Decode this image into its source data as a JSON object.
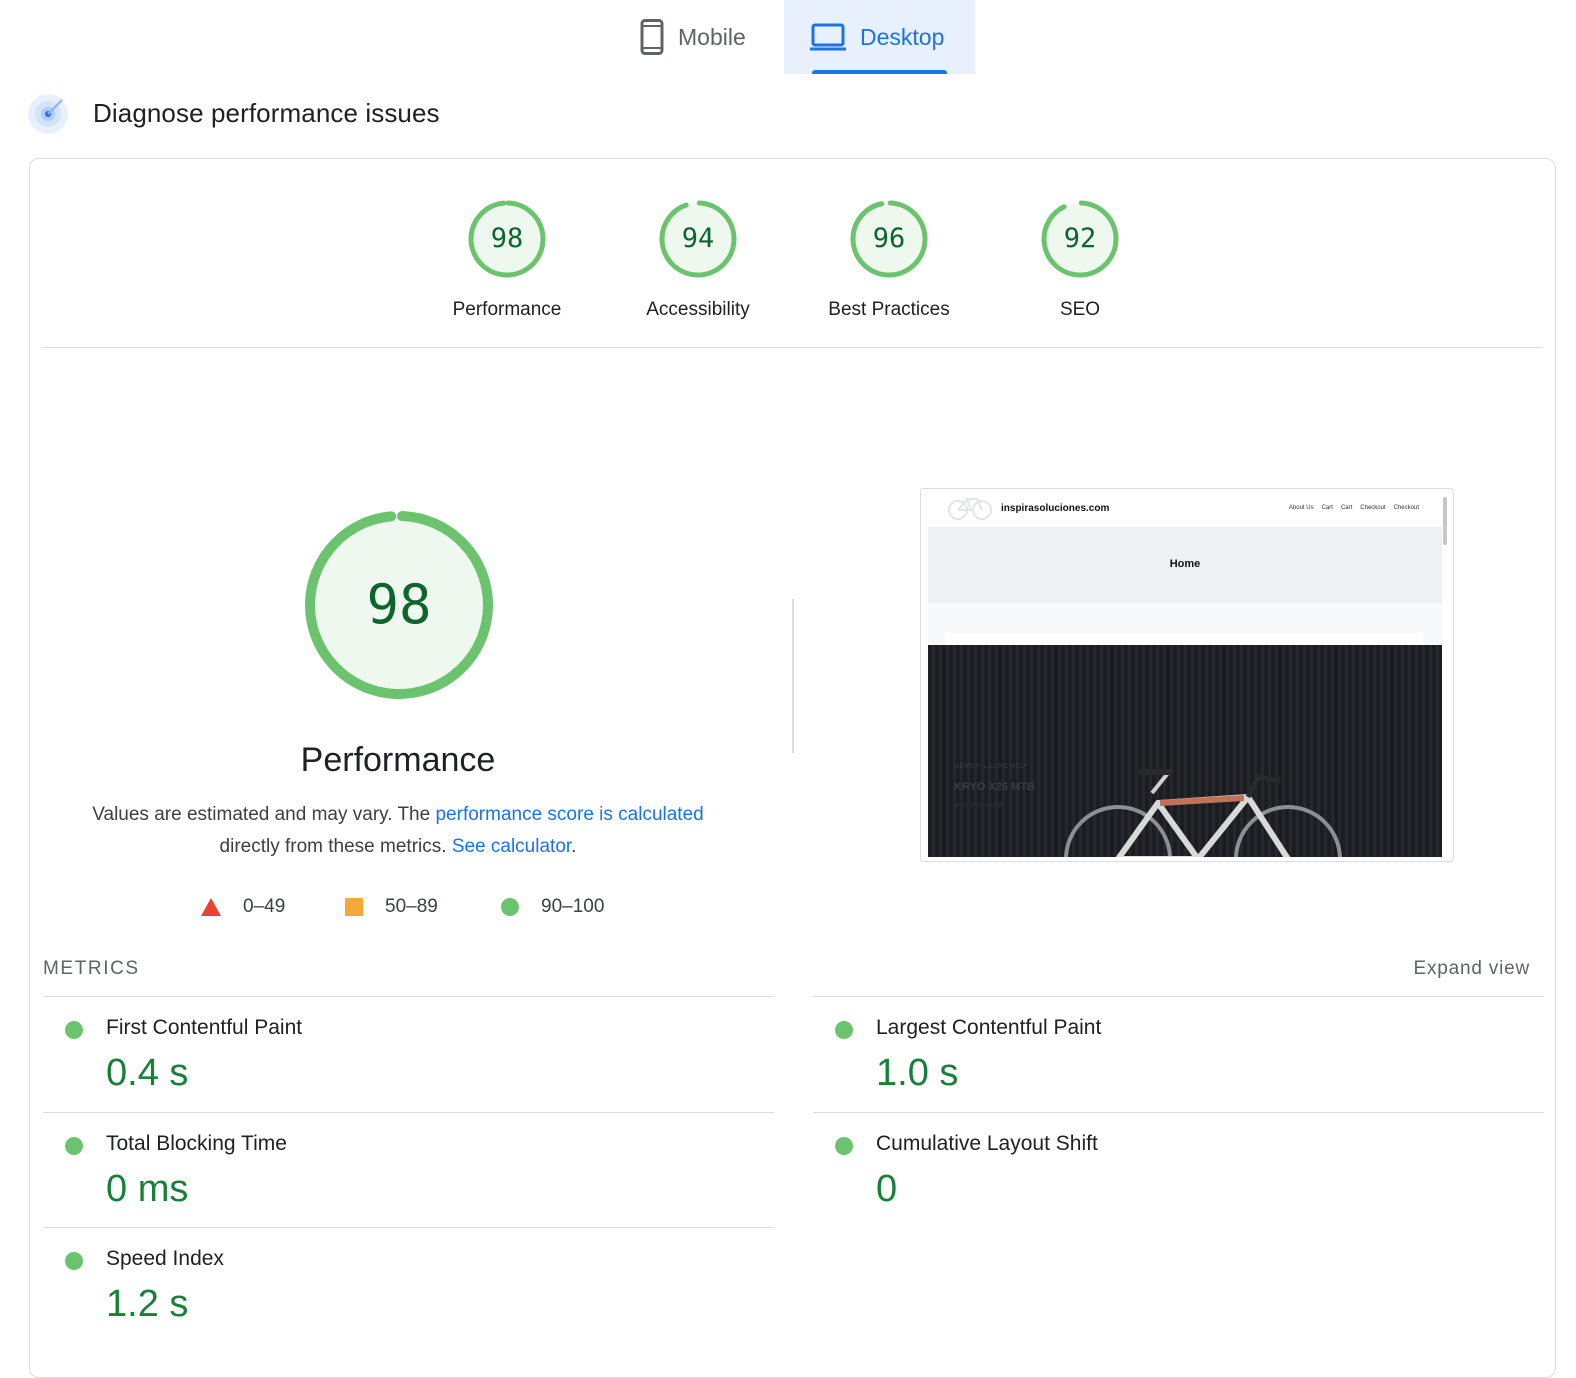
{
  "tabs": [
    {
      "label": "Mobile",
      "icon": "phone-icon",
      "active": false
    },
    {
      "label": "Desktop",
      "icon": "laptop-icon",
      "active": true
    }
  ],
  "section": {
    "title": "Diagnose performance issues",
    "icon": "diagnose-icon"
  },
  "categories": [
    {
      "label": "Performance",
      "score": "98"
    },
    {
      "label": "Accessibility",
      "score": "94"
    },
    {
      "label": "Best Practices",
      "score": "96"
    },
    {
      "label": "SEO",
      "score": "92"
    }
  ],
  "performance": {
    "score": "98",
    "title": "Performance",
    "description_prefix": "Values are estimated and may vary. The ",
    "link_score": "performance score is calculated",
    "description_middle": " directly from these metrics. ",
    "link_calculator": "See calculator",
    "description_suffix": "."
  },
  "legend": [
    {
      "range": "0–49",
      "shape": "triangle",
      "color": "#e94235"
    },
    {
      "range": "50–89",
      "shape": "square",
      "color": "#f2a93a"
    },
    {
      "range": "90–100",
      "shape": "circle",
      "color": "#6bc46d"
    }
  ],
  "screenshot": {
    "site_name": "inspirasoluciones.com",
    "menu": [
      "About Us",
      "Cart",
      "Cart",
      "Checkout",
      "Checkout"
    ],
    "home": "Home",
    "hero_kicker": "NEWLY LAUNCHED",
    "hero_title": "KRYO X26 MTB",
    "hero_sub": "SPECIFICATIONS"
  },
  "metrics": {
    "title": "METRICS",
    "expand_label": "Expand view",
    "items": [
      {
        "name": "First Contentful Paint",
        "value": "0.4 s",
        "status": "good"
      },
      {
        "name": "Largest Contentful Paint",
        "value": "1.0 s",
        "status": "good"
      },
      {
        "name": "Total Blocking Time",
        "value": "0 ms",
        "status": "good"
      },
      {
        "name": "Cumulative Layout Shift",
        "value": "0",
        "status": "good"
      },
      {
        "name": "Speed Index",
        "value": "1.2 s",
        "status": "good"
      }
    ]
  },
  "colors": {
    "accent": "#1a73e8",
    "pass": "#0cce6b",
    "pass_ring": "#6bc46d",
    "pass_text": "#188038"
  }
}
